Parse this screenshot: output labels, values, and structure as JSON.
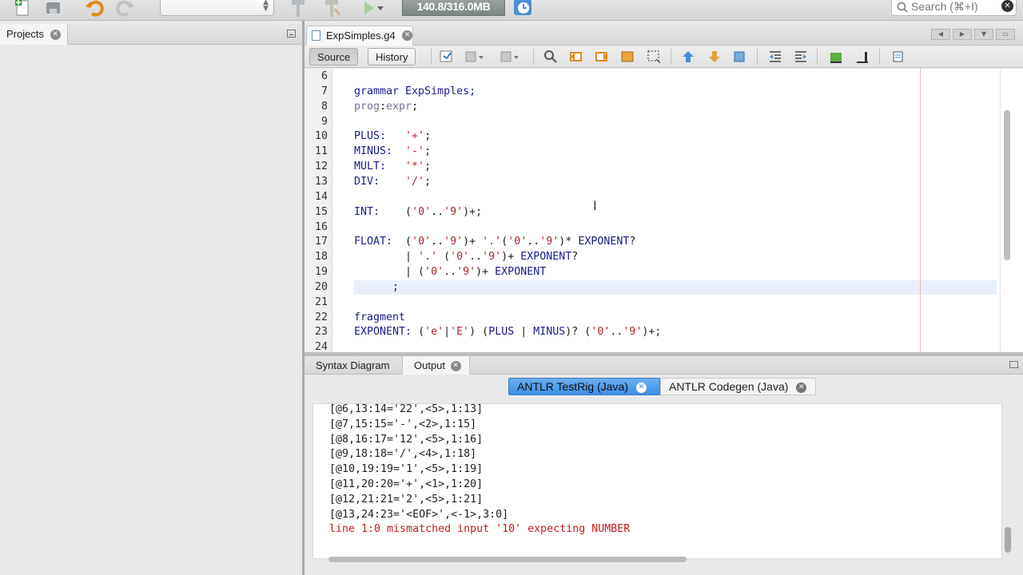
{
  "toolbar": {
    "memory": "140.8/316.0MB",
    "search_placeholder": "Search (⌘+I)",
    "config_value": ""
  },
  "projects": {
    "tab_label": "Projects"
  },
  "editor": {
    "file_tab": "ExpSimples.g4",
    "source_label": "Source",
    "history_label": "History",
    "lines": [
      {
        "n": "6",
        "segs": []
      },
      {
        "n": "7",
        "segs": [
          [
            "kw",
            "grammar ExpSimples;"
          ]
        ]
      },
      {
        "n": "8",
        "segs": [
          [
            "gry",
            "prog"
          ],
          [
            "plain",
            ":"
          ],
          [
            "gry",
            "expr"
          ],
          [
            "plain",
            ";"
          ]
        ]
      },
      {
        "n": "9",
        "segs": []
      },
      {
        "n": "10",
        "segs": [
          [
            "kw",
            "PLUS:   "
          ],
          [
            "str",
            "'+'"
          ],
          [
            "plain",
            ";"
          ]
        ]
      },
      {
        "n": "11",
        "segs": [
          [
            "kw",
            "MINUS:  "
          ],
          [
            "str",
            "'-'"
          ],
          [
            "plain",
            ";"
          ]
        ]
      },
      {
        "n": "12",
        "segs": [
          [
            "kw",
            "MULT:   "
          ],
          [
            "str",
            "'*'"
          ],
          [
            "plain",
            ";"
          ]
        ]
      },
      {
        "n": "13",
        "segs": [
          [
            "kw",
            "DIV:    "
          ],
          [
            "str",
            "'/'"
          ],
          [
            "plain",
            ";"
          ]
        ]
      },
      {
        "n": "14",
        "segs": []
      },
      {
        "n": "15",
        "segs": [
          [
            "kw",
            "INT:    "
          ],
          [
            "plain",
            "("
          ],
          [
            "str",
            "'0'"
          ],
          [
            "plain",
            ".."
          ],
          [
            "str",
            "'9'"
          ],
          [
            "plain",
            ")+;"
          ]
        ]
      },
      {
        "n": "16",
        "segs": []
      },
      {
        "n": "17",
        "segs": [
          [
            "kw",
            "FLOAT:  "
          ],
          [
            "plain",
            "("
          ],
          [
            "str",
            "'0'"
          ],
          [
            "plain",
            ".."
          ],
          [
            "str",
            "'9'"
          ],
          [
            "plain",
            ")+ "
          ],
          [
            "str",
            "'.'"
          ],
          [
            "plain",
            "("
          ],
          [
            "str",
            "'0'"
          ],
          [
            "plain",
            ".."
          ],
          [
            "str",
            "'9'"
          ],
          [
            "plain",
            ")* "
          ],
          [
            "kw",
            "EXPONENT"
          ],
          [
            "plain",
            "?"
          ]
        ]
      },
      {
        "n": "18",
        "segs": [
          [
            "plain",
            "        | "
          ],
          [
            "str",
            "'.'"
          ],
          [
            "plain",
            " ("
          ],
          [
            "str",
            "'0'"
          ],
          [
            "plain",
            ".."
          ],
          [
            "str",
            "'9'"
          ],
          [
            "plain",
            ")+ "
          ],
          [
            "kw",
            "EXPONENT"
          ],
          [
            "plain",
            "?"
          ]
        ]
      },
      {
        "n": "19",
        "segs": [
          [
            "plain",
            "        | ("
          ],
          [
            "str",
            "'0'"
          ],
          [
            "plain",
            ".."
          ],
          [
            "str",
            "'9'"
          ],
          [
            "plain",
            ")+ "
          ],
          [
            "kw",
            "EXPONENT"
          ]
        ]
      },
      {
        "n": "20",
        "segs": [
          [
            "plain",
            "      ;"
          ]
        ]
      },
      {
        "n": "21",
        "segs": []
      },
      {
        "n": "22",
        "segs": [
          [
            "kw",
            "fragment"
          ]
        ]
      },
      {
        "n": "23",
        "segs": [
          [
            "kw",
            "EXPONENT: "
          ],
          [
            "plain",
            "("
          ],
          [
            "str",
            "'e'"
          ],
          [
            "plain",
            "|"
          ],
          [
            "str",
            "'E'"
          ],
          [
            "plain",
            ") ("
          ],
          [
            "kw",
            "PLUS"
          ],
          [
            "plain",
            " | "
          ],
          [
            "kw",
            "MINUS"
          ],
          [
            "plain",
            ")? ("
          ],
          [
            "str",
            "'0'"
          ],
          [
            "plain",
            ".."
          ],
          [
            "str",
            "'9'"
          ],
          [
            "plain",
            ")+;"
          ]
        ]
      },
      {
        "n": "24",
        "segs": []
      }
    ]
  },
  "bottom": {
    "tab_syntax": "Syntax Diagram",
    "tab_output": "Output",
    "subtab_testrig": "ANTLR TestRig (Java)",
    "subtab_codegen": "ANTLR Codegen (Java)",
    "output_lines": [
      {
        "text": "[@6,13:14='22',<5>,1:13]",
        "err": false
      },
      {
        "text": "[@7,15:15='-',<2>,1:15]",
        "err": false
      },
      {
        "text": "[@8,16:17='12',<5>,1:16]",
        "err": false
      },
      {
        "text": "[@9,18:18='/',<4>,1:18]",
        "err": false
      },
      {
        "text": "[@10,19:19='1',<5>,1:19]",
        "err": false
      },
      {
        "text": "[@11,20:20='+',<1>,1:20]",
        "err": false
      },
      {
        "text": "[@12,21:21='2',<5>,1:21]",
        "err": false
      },
      {
        "text": "[@13,24:23='<EOF>',<-1>,3:0]",
        "err": false
      },
      {
        "text": "line 1:0 mismatched input '10' expecting NUMBER",
        "err": true
      }
    ]
  }
}
